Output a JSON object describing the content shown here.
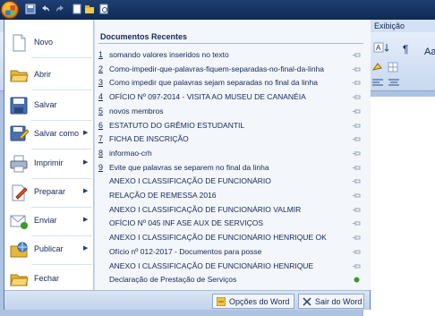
{
  "ribbon": {
    "tab_exibicao": "Exibição",
    "paste_fragment": "Aa",
    "pilcrow": "¶"
  },
  "menu": {
    "left_items": [
      {
        "label": "Novo",
        "icon": "new-document-icon",
        "has_submenu": false
      },
      {
        "label": "Abrir",
        "icon": "open-folder-icon",
        "has_submenu": false
      },
      {
        "label": "Salvar",
        "icon": "save-icon",
        "has_submenu": false
      },
      {
        "label": "Salvar como",
        "icon": "save-as-icon",
        "has_submenu": true
      },
      {
        "label": "Imprimir",
        "icon": "printer-icon",
        "has_submenu": true
      },
      {
        "label": "Preparar",
        "icon": "prepare-icon",
        "has_submenu": true
      },
      {
        "label": "Enviar",
        "icon": "send-icon",
        "has_submenu": true
      },
      {
        "label": "Publicar",
        "icon": "publish-icon",
        "has_submenu": true
      },
      {
        "label": "Fechar",
        "icon": "close-document-icon",
        "has_submenu": false
      }
    ],
    "recent_title": "Documentos Recentes",
    "recent_documents": [
      {
        "number": "1",
        "name": "somando valores inseridos no texto",
        "pinned": false
      },
      {
        "number": "2",
        "name": "Como-impedir-que-palavras-fiquem-separadas-no-final-da-linha",
        "pinned": false
      },
      {
        "number": "3",
        "name": "Como impedir que palavras sejam separadas no final da linha",
        "pinned": false
      },
      {
        "number": "4",
        "name": "OFÍCIO Nº 097-2014 - VISITA AO MUSEU DE CANANÉIA",
        "pinned": false
      },
      {
        "number": "5",
        "name": "novos membros",
        "pinned": false
      },
      {
        "number": "6",
        "name": "ESTATUTO DO GRÊMIO ESTUDANTIL",
        "pinned": false
      },
      {
        "number": "7",
        "name": "FICHA DE INSCRIÇÃO",
        "pinned": false
      },
      {
        "number": "8",
        "name": "informao-crh",
        "pinned": false
      },
      {
        "number": "9",
        "name": "Evite que palavras se separem no final da linha",
        "pinned": false
      },
      {
        "number": "",
        "name": "ANEXO I CLASSIFICAÇÃO DE FUNCIONÁRIO",
        "pinned": false
      },
      {
        "number": "",
        "name": "RELAÇÃO DE REMESSA 2016",
        "pinned": false
      },
      {
        "number": "",
        "name": "ANEXO I CLASSIFICAÇÃO DE FUNCIONÁRIO VALMIR",
        "pinned": false
      },
      {
        "number": "",
        "name": "OFÍCIO Nº 045 INF ASE AUX DE SERVIÇOS",
        "pinned": false
      },
      {
        "number": "",
        "name": "ANEXO I CLASSIFICAÇÃO DE FUNCIONÁRIO HENRIQUE OK",
        "pinned": false
      },
      {
        "number": "",
        "name": "Ofício nº 012-2017 - Documentos para posse",
        "pinned": false
      },
      {
        "number": "",
        "name": "ANEXO I CLASSIFICAÇÃO DE FUNCIONÁRIO HENRIQUE",
        "pinned": false
      },
      {
        "number": "",
        "name": "Declaração de Prestação de Serviços",
        "pinned": true
      }
    ],
    "options_button": "Opções do Word",
    "exit_button": "Sair do Word"
  },
  "colors": {
    "accent": "#5a7cb4",
    "text": "#15275a",
    "pin_green": "#3a9a2a"
  }
}
